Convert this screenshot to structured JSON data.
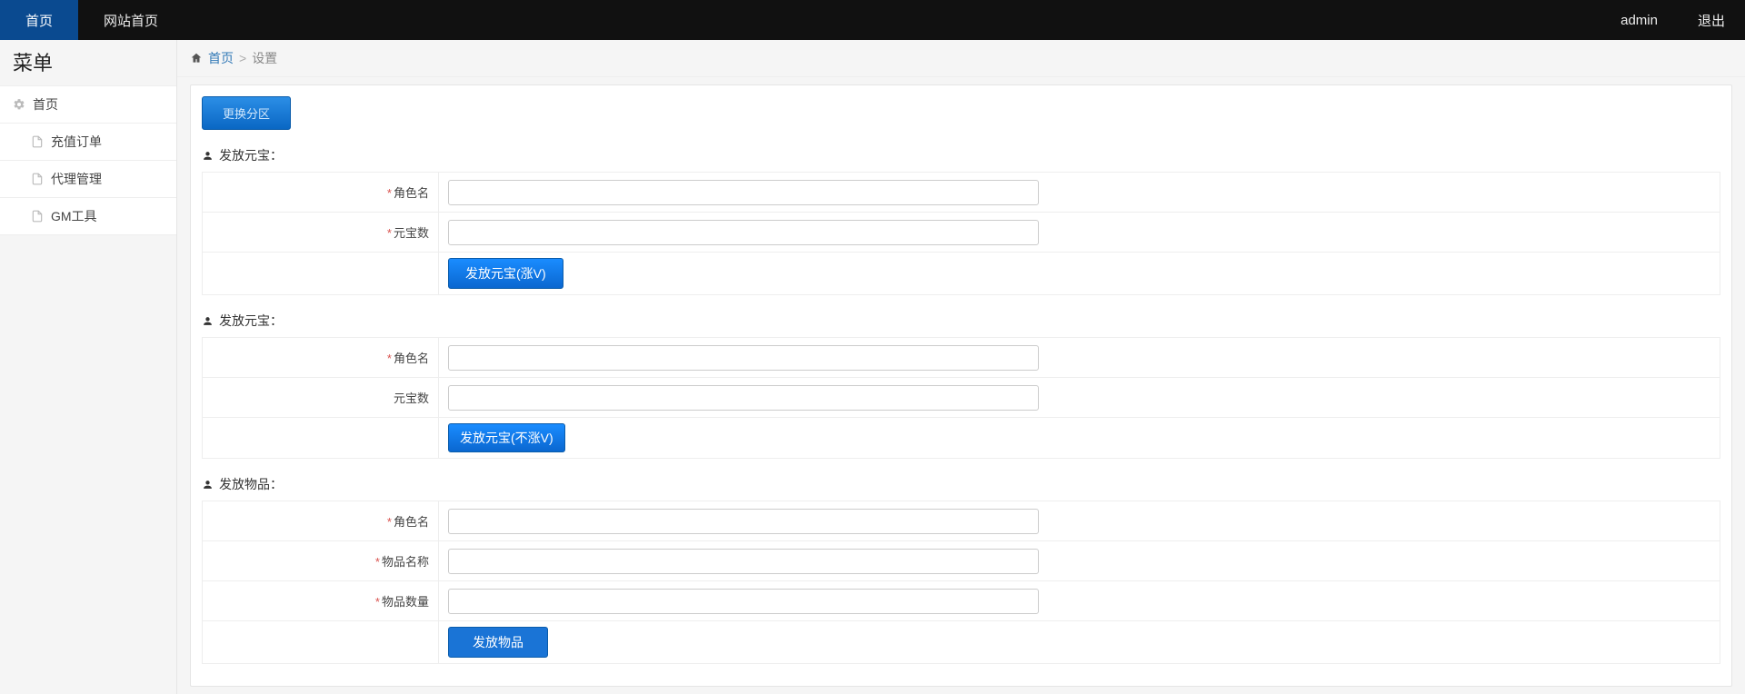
{
  "topnav": {
    "items": [
      {
        "label": "首页",
        "active": true
      },
      {
        "label": "网站首页",
        "active": false
      }
    ],
    "right": [
      {
        "label": "admin"
      },
      {
        "label": "退出"
      }
    ]
  },
  "sidebar": {
    "title": "菜单",
    "root": {
      "label": "首页"
    },
    "items": [
      {
        "label": "充值订单"
      },
      {
        "label": "代理管理"
      },
      {
        "label": "GM工具"
      }
    ]
  },
  "breadcrumb": {
    "home_link": "首页",
    "current": "设置"
  },
  "switch_zone_btn": "更换分区",
  "sections": [
    {
      "title": "发放元宝：",
      "rows": [
        {
          "required": true,
          "label": "角色名",
          "value": ""
        },
        {
          "required": true,
          "label": "元宝数",
          "value": ""
        }
      ],
      "button": "发放元宝(涨V)"
    },
    {
      "title": "发放元宝：",
      "rows": [
        {
          "required": true,
          "label": "角色名",
          "value": ""
        },
        {
          "required": false,
          "label": "元宝数",
          "value": ""
        }
      ],
      "button": "发放元宝(不涨V)"
    },
    {
      "title": "发放物品：",
      "rows": [
        {
          "required": true,
          "label": "角色名",
          "value": ""
        },
        {
          "required": true,
          "label": "物品名称",
          "value": ""
        },
        {
          "required": true,
          "label": "物品数量",
          "value": ""
        }
      ],
      "button": "发放物品"
    }
  ]
}
